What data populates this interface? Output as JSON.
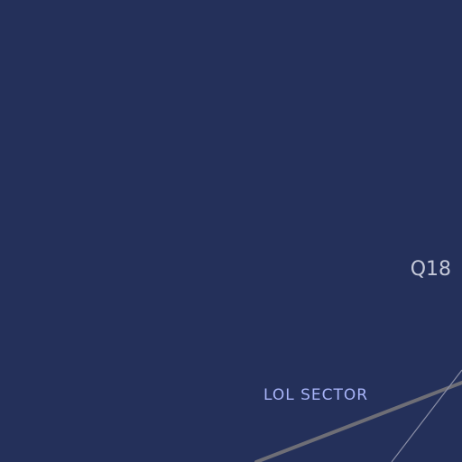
{
  "map": {
    "sector_label": "LOL SECTOR",
    "grid_label": "Q18"
  },
  "colors": {
    "background": "#24305a",
    "sector_label": "#a8b4f8",
    "grid_label": "#c4c8d8",
    "main_road": "#6e6e76",
    "minor_line": "#8a8ea6"
  }
}
